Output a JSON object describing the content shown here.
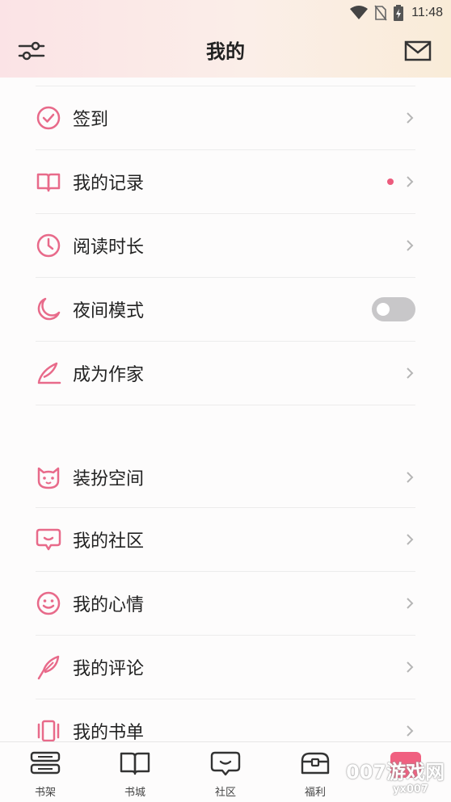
{
  "status_bar": {
    "time": "11:48"
  },
  "header": {
    "title": "我的"
  },
  "menu_group_1": [
    {
      "label": "签到",
      "icon": "check-circle-icon"
    },
    {
      "label": "我的记录",
      "icon": "open-book-icon",
      "has_dot": true
    },
    {
      "label": "阅读时长",
      "icon": "clock-icon"
    },
    {
      "label": "夜间模式",
      "icon": "moon-icon",
      "toggle": false
    },
    {
      "label": "成为作家",
      "icon": "quill-icon"
    }
  ],
  "menu_group_2": [
    {
      "label": "装扮空间",
      "icon": "cat-face-icon"
    },
    {
      "label": "我的社区",
      "icon": "chat-bubble-icon"
    },
    {
      "label": "我的心情",
      "icon": "smiley-icon"
    },
    {
      "label": "我的评论",
      "icon": "feather-icon"
    },
    {
      "label": "我的书单",
      "icon": "booklist-icon"
    }
  ],
  "tab_bar": [
    {
      "label": "书架",
      "icon": "bookshelf-icon"
    },
    {
      "label": "书城",
      "icon": "book-icon"
    },
    {
      "label": "社区",
      "icon": "community-icon"
    },
    {
      "label": "福利",
      "icon": "treasure-chest-icon"
    },
    {
      "label": "",
      "icon": "my-tab-icon",
      "active": true
    }
  ],
  "watermark": {
    "line1": "007游戏网",
    "line2": "yx007"
  },
  "colors": {
    "accent": "#ec5b7d",
    "icon_pink": "#e86a8a",
    "toggle_off": "#c8c7c9"
  }
}
